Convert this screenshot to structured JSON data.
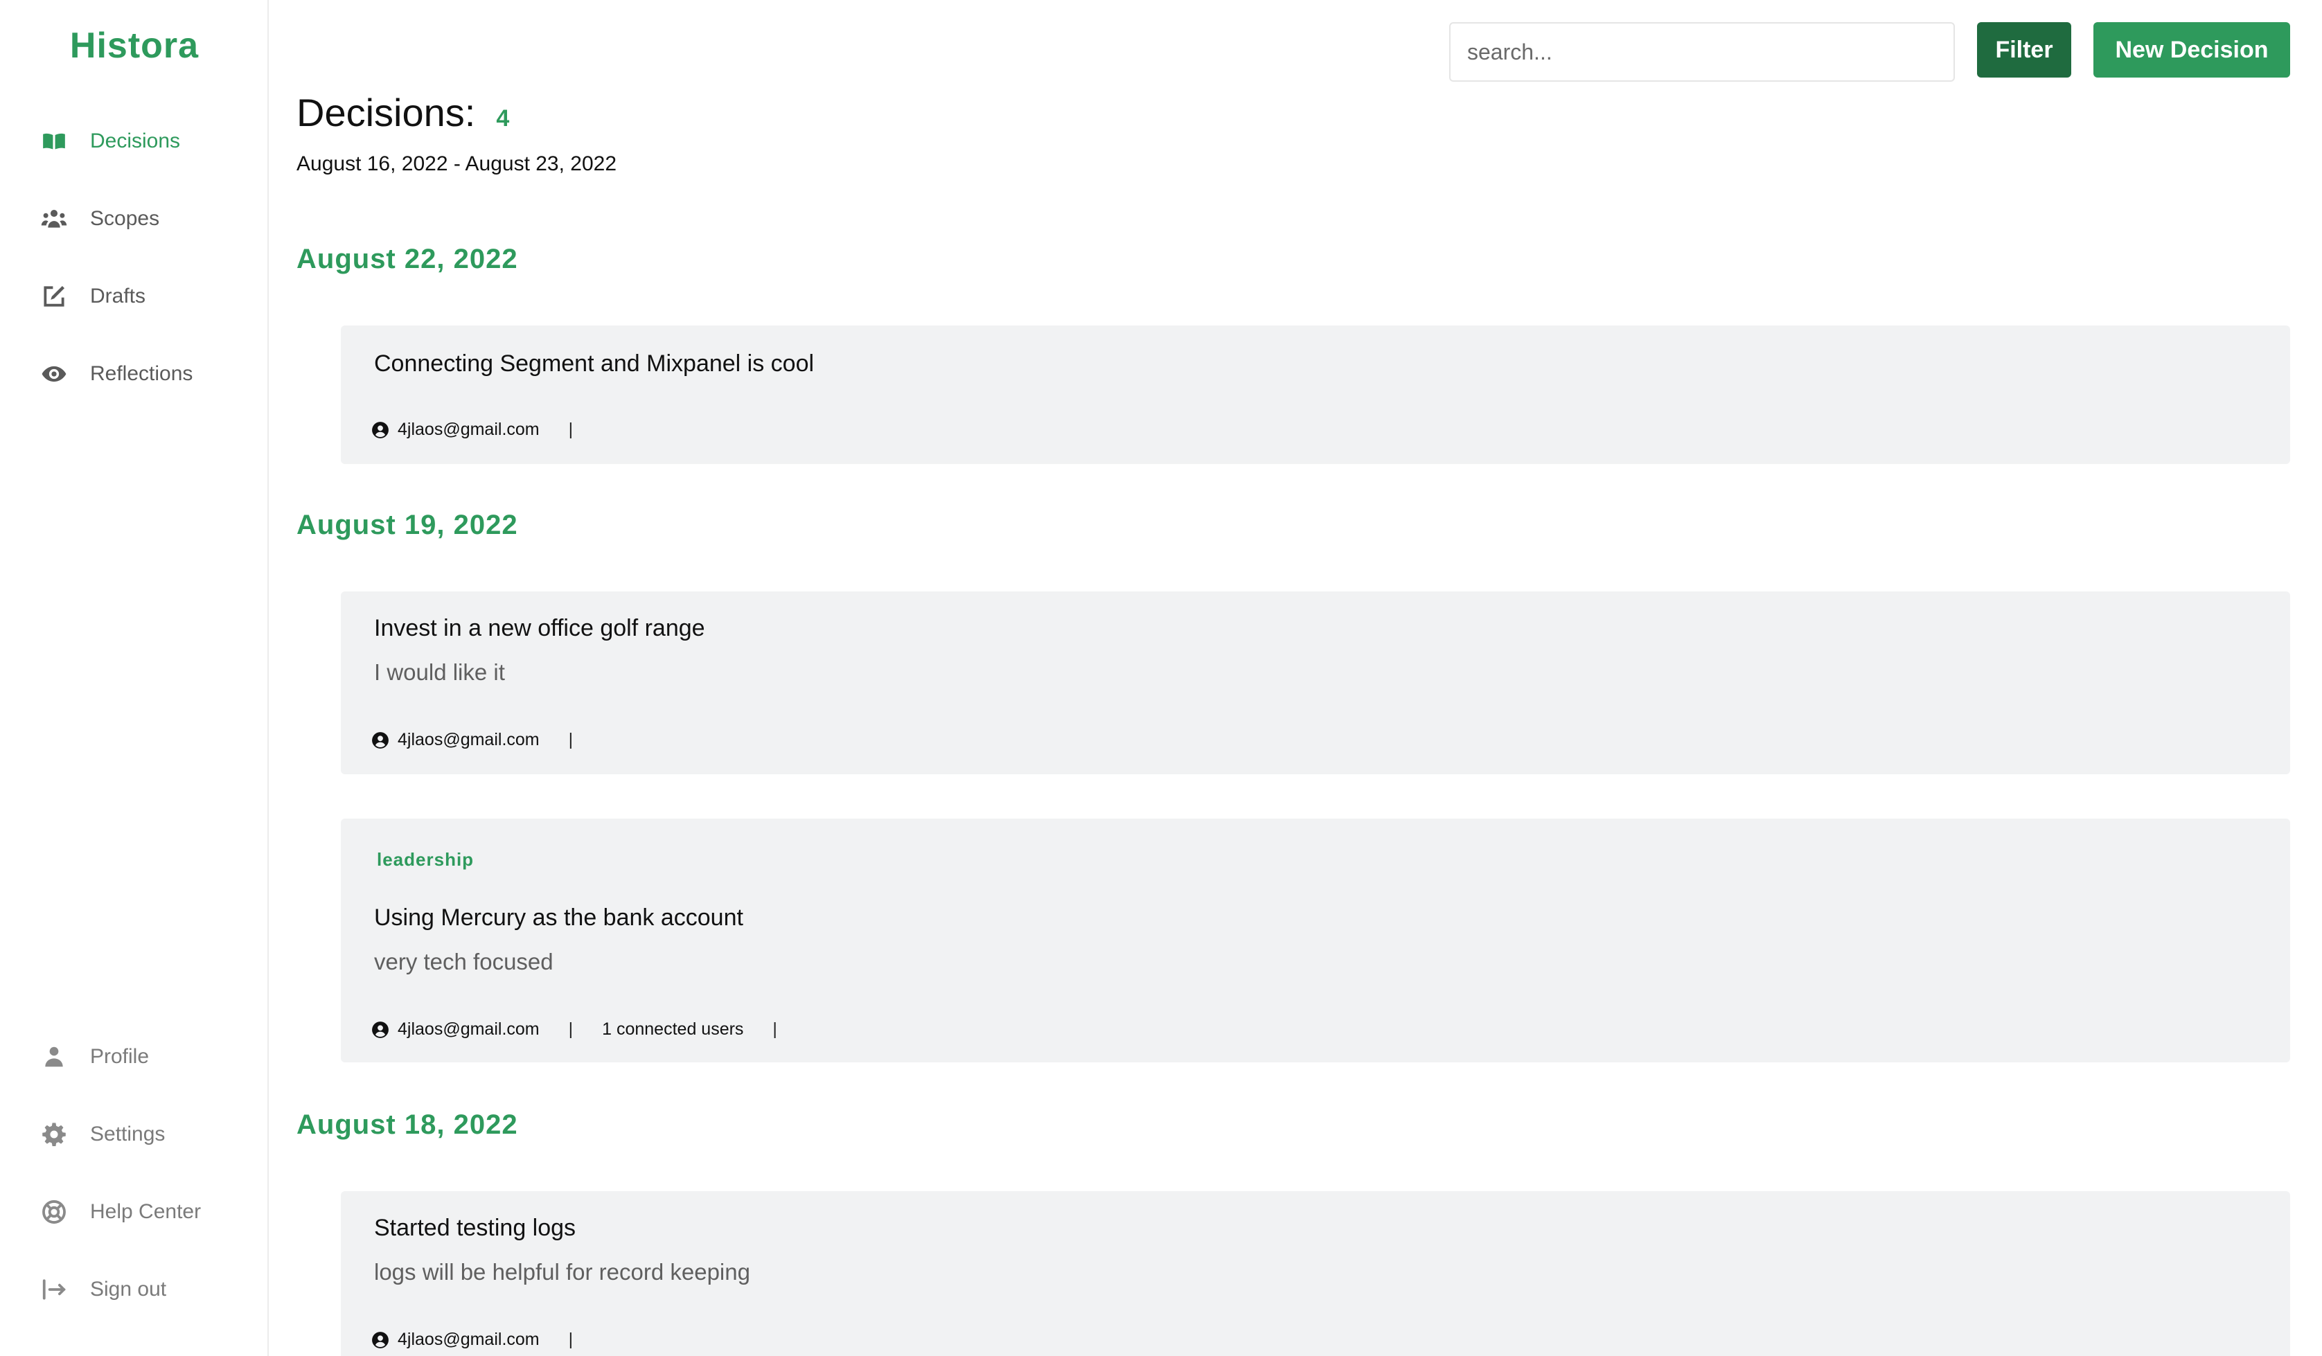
{
  "app": {
    "brand": "Histora"
  },
  "sidebar": {
    "items": [
      {
        "label": "Decisions",
        "icon": "book-icon",
        "active": true
      },
      {
        "label": "Scopes",
        "icon": "users-icon"
      },
      {
        "label": "Drafts",
        "icon": "edit-icon"
      },
      {
        "label": "Reflections",
        "icon": "eye-icon"
      }
    ],
    "bottom_items": [
      {
        "label": "Profile",
        "icon": "user-icon"
      },
      {
        "label": "Settings",
        "icon": "gear-icon"
      },
      {
        "label": "Help Center",
        "icon": "lifebuoy-icon"
      },
      {
        "label": "Sign out",
        "icon": "sign-out-icon"
      }
    ]
  },
  "toolbar": {
    "search_placeholder": "search...",
    "filter_label": "Filter",
    "new_decision_label": "New Decision"
  },
  "main": {
    "title": "Decisions:",
    "count": "4",
    "date_range": "August 16, 2022 - August 23, 2022",
    "groups": [
      {
        "date": "August 22, 2022",
        "decisions": [
          {
            "title": "Connecting Segment and Mixpanel is cool",
            "user": "4jlaos@gmail.com"
          }
        ]
      },
      {
        "date": "August 19, 2022",
        "decisions": [
          {
            "title": "Invest in a new office golf range",
            "description": "I would like it",
            "user": "4jlaos@gmail.com"
          },
          {
            "tag": "leadership",
            "title": "Using Mercury as the bank account",
            "description": "very tech focused",
            "user": "4jlaos@gmail.com",
            "connected": "1 connected users"
          }
        ]
      },
      {
        "date": "August 18, 2022",
        "decisions": [
          {
            "title": "Started testing logs",
            "description": "logs will be helpful for record keeping",
            "user": "4jlaos@gmail.com"
          }
        ]
      }
    ]
  },
  "meta": {
    "separator": "|"
  },
  "colors": {
    "accent": "#2e9a5c",
    "accent_dark": "#1f6b3f",
    "card_bg": "#f1f2f3"
  }
}
